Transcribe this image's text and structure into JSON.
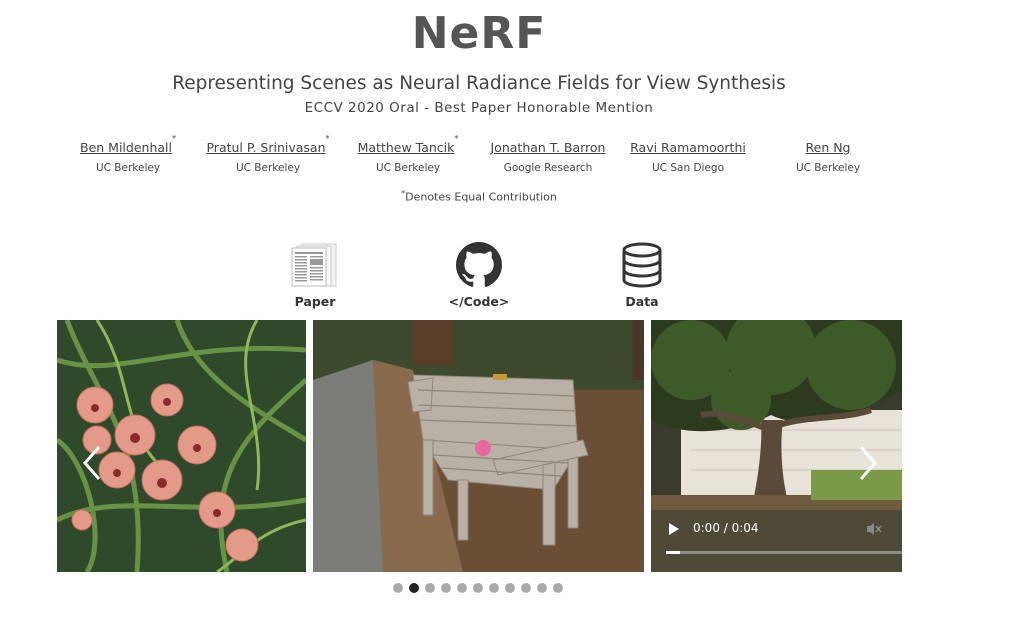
{
  "header": {
    "title": "NeRF",
    "subtitle": "Representing Scenes as Neural Radiance Fields for View Synthesis",
    "venue": "ECCV 2020 Oral - Best Paper Honorable Mention"
  },
  "authors": [
    {
      "name": "Ben Mildenhall",
      "mark": "*",
      "affiliation": "UC Berkeley"
    },
    {
      "name": "Pratul P. Srinivasan",
      "mark": "*",
      "affiliation": "UC Berkeley"
    },
    {
      "name": "Matthew Tancik",
      "mark": "*",
      "affiliation": "UC Berkeley"
    },
    {
      "name": "Jonathan T. Barron",
      "mark": "",
      "affiliation": "Google Research"
    },
    {
      "name": "Ravi Ramamoorthi",
      "mark": "",
      "affiliation": "UC San Diego"
    },
    {
      "name": "Ren Ng",
      "mark": "",
      "affiliation": "UC Berkeley"
    }
  ],
  "equal_note": {
    "mark": "*",
    "text": "Denotes Equal Contribution"
  },
  "links": [
    {
      "label": "Paper",
      "icon": "paper-thumbnail-icon"
    },
    {
      "label": "</Code>",
      "icon": "github-icon"
    },
    {
      "label": "Data",
      "icon": "database-icon"
    }
  ],
  "carousel": {
    "slides": [
      "orchid-flowers",
      "wooden-bench",
      "tree-scene-video"
    ],
    "video_time": "0:00 / 0:04",
    "dot_count": 11,
    "active_dot": 1,
    "prev_icon": "chevron-left-icon",
    "next_icon": "chevron-right-icon"
  }
}
